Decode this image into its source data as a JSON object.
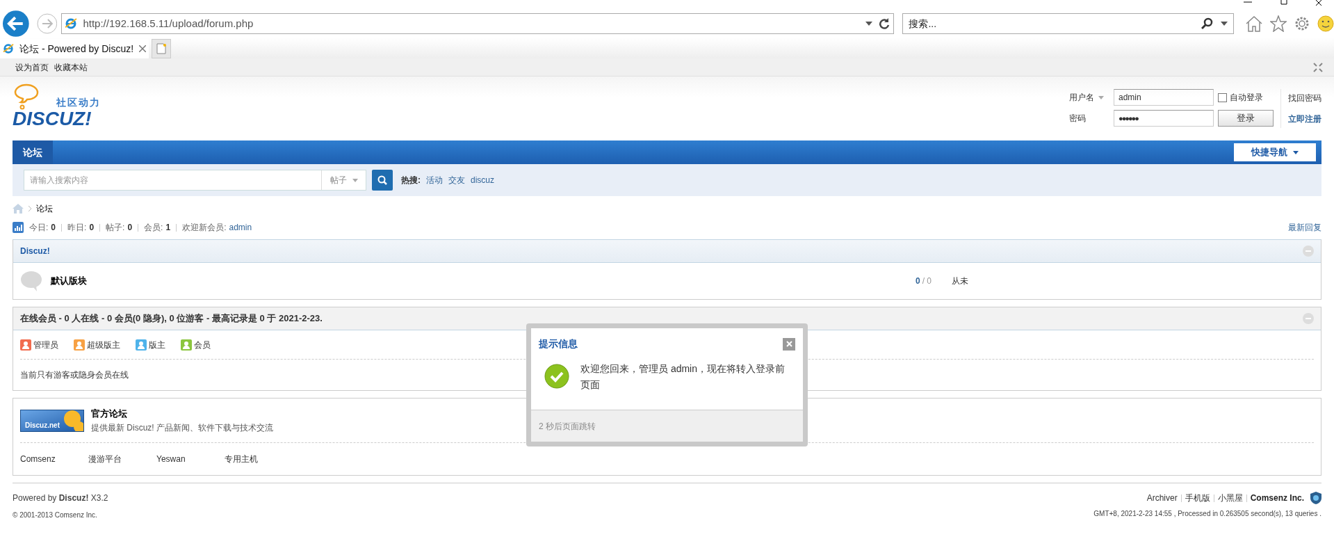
{
  "browser": {
    "address": "http://192.168.5.11/upload/forum.php",
    "search_placeholder": "搜索...",
    "tab_title": "论坛 - Powered by Discuz!",
    "favorites": [
      "设为首页",
      "收藏本站"
    ]
  },
  "header": {
    "tagline": "社区动力",
    "wordmark": "DISCUZ!"
  },
  "login": {
    "username_label": "用户名",
    "username": "admin",
    "password_label": "密码",
    "password": "●●●●●●",
    "auto_login": {
      "label": "自动登录",
      "checked": false
    },
    "login_button": "登录",
    "links": [
      "找回密码",
      "立即注册"
    ]
  },
  "nav": {
    "tabs": [
      {
        "label": "论坛",
        "selected": true
      }
    ],
    "quick_nav": "快捷导航"
  },
  "search": {
    "placeholder": "请输入搜索内容",
    "type": "帖子",
    "hot_label": "热搜:",
    "hot": [
      "活动",
      "交友",
      "discuz"
    ]
  },
  "breadcrumb": [
    "论坛"
  ],
  "stats": {
    "items": [
      {
        "label": "今日:",
        "value": "0"
      },
      {
        "label": "昨日:",
        "value": "0"
      },
      {
        "label": "帖子:",
        "value": "0"
      },
      {
        "label": "会员:",
        "value": "1"
      }
    ],
    "welcome_label": "欢迎新会员:",
    "welcome_user": "admin",
    "latest_link": "最新回复"
  },
  "category": {
    "title": "Discuz!",
    "forums": [
      {
        "name": "默认版块",
        "threads": "0",
        "posts": "/ 0",
        "last_post": "从未"
      }
    ]
  },
  "online": {
    "title": "在线会员 - 0 人在线 - 0 会员(0 隐身), 0 位游客 - 最高记录是 0 于 2021-2-23.",
    "legend": [
      {
        "label": "管理员",
        "color": "#f26c4f"
      },
      {
        "label": "超级版主",
        "color": "#f7a144"
      },
      {
        "label": "版主",
        "color": "#4fb3ea"
      },
      {
        "label": "会员",
        "color": "#8cc63f"
      }
    ],
    "note": "当前只有游客或隐身会员在线"
  },
  "friend_links": {
    "logo_text": "Discuz.net",
    "title": "官方论坛",
    "description": "提供最新 Discuz! 产品新闻、软件下载与技术交流",
    "items": [
      "Comsenz",
      "漫游平台",
      "Yeswan",
      "专用主机"
    ]
  },
  "footer": {
    "powered": "Powered by **Discuz!** X3.2",
    "copyright": "© 2001-2013 Comsenz Inc.",
    "links": [
      {
        "label": "Archiver",
        "bold": false
      },
      {
        "label": "手机版",
        "bold": false
      },
      {
        "label": "小黑屋",
        "bold": false
      },
      {
        "label": "Comsenz Inc.",
        "bold": true
      }
    ],
    "stats": "GMT+8, 2021-2-23 14:55 , Processed in 0.263505 second(s), 13 queries ."
  },
  "dialog": {
    "title": "提示信息",
    "message": "欢迎您回来，管理员 admin，现在将转入登录前页面",
    "countdown": "2 秒后页面跳转"
  }
}
